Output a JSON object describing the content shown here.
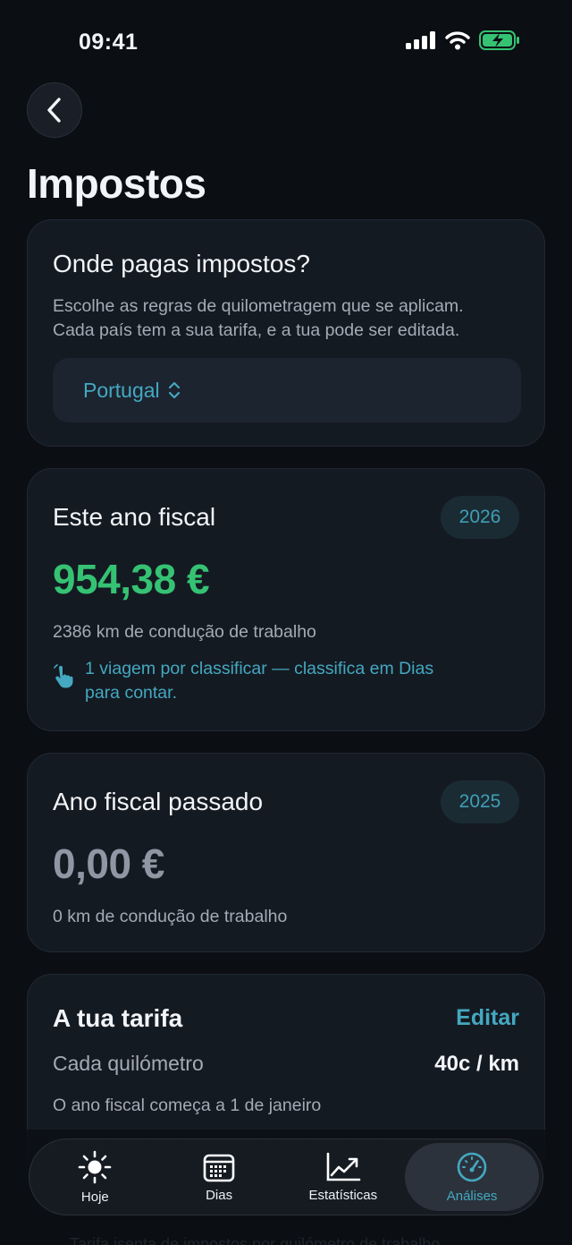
{
  "status": {
    "time": "09:41"
  },
  "page": {
    "title": "Impostos"
  },
  "tax_location": {
    "title": "Onde pagas impostos?",
    "description_line1": "Escolhe as regras de quilometragem que se aplicam.",
    "description_line2": "Cada país tem a sua tarifa, e a tua pode ser editada.",
    "selected_country": "Portugal"
  },
  "current_year": {
    "title": "Este ano fiscal",
    "year": "2026",
    "amount": "954,38 €",
    "distance": "2386 km de condução de trabalho",
    "notice_line1": "1 viagem por classificar — classifica em Dias",
    "notice_line2": "para contar."
  },
  "previous_year": {
    "title": "Ano fiscal passado",
    "year": "2025",
    "amount": "0,00 €",
    "distance": "0 km de condução de trabalho"
  },
  "rate": {
    "title": "A tua tarifa",
    "edit_label": "Editar",
    "per_km_label": "Cada quilómetro",
    "per_km_value": "40c / km",
    "fiscal_start": "O ano fiscal começa a 1 de janeiro"
  },
  "footer_partial_text": "Tarifa isenta de impostos por quilómetro de trabalho",
  "tabs": [
    {
      "label": "Hoje",
      "icon": "sun-icon"
    },
    {
      "label": "Dias",
      "icon": "calendar-icon"
    },
    {
      "label": "Estatísticas",
      "icon": "chart-icon"
    },
    {
      "label": "Análises",
      "icon": "gauge-icon",
      "active": true
    }
  ],
  "colors": {
    "background": "#0b0e13",
    "card": "#141a22",
    "accent": "#44a8c0",
    "positive": "#35c273",
    "muted_amount": "#8e97a3"
  }
}
